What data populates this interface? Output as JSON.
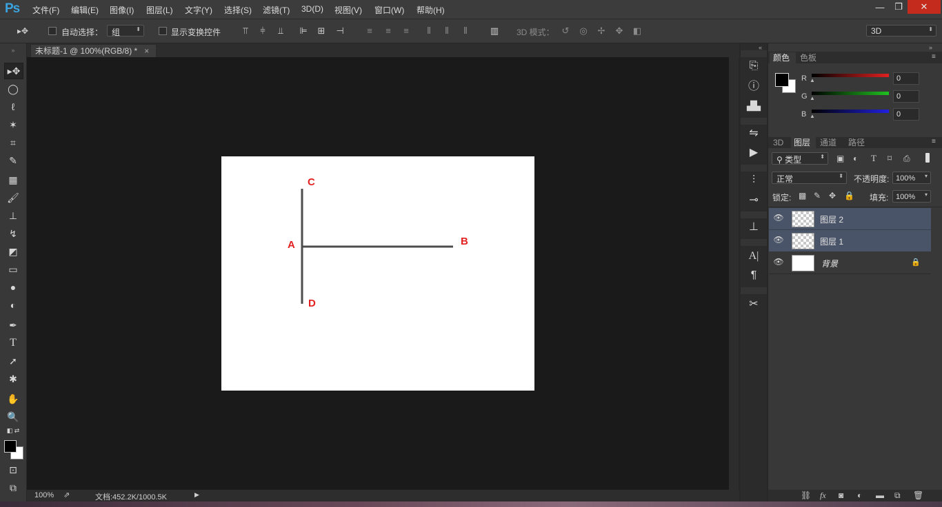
{
  "app": {
    "logo": "Ps"
  },
  "menu": [
    "文件(F)",
    "编辑(E)",
    "图像(I)",
    "图层(L)",
    "文字(Y)",
    "选择(S)",
    "滤镜(T)",
    "3D(D)",
    "视图(V)",
    "窗口(W)",
    "帮助(H)"
  ],
  "window_controls": {
    "minimize": "—",
    "restore": "❐",
    "close": "✕"
  },
  "options": {
    "auto_select_label": "自动选择：",
    "auto_select_value": "组",
    "show_transform_label": "显示变换控件",
    "mode3d_label": "3D 模式：",
    "workspace_value": "3D"
  },
  "document": {
    "tab_title": "未标题-1 @ 100%(RGB/8) *",
    "tab_close": "×",
    "zoom": "100%",
    "doc_info": "文档:452.2K/1000.5K"
  },
  "canvas": {
    "labels": {
      "a": "A",
      "b": "B",
      "c": "C",
      "d": "D"
    },
    "line_color": "#4d4d4d",
    "label_color": "#e32020"
  },
  "color_panel": {
    "tabs": [
      "颜色",
      "色板"
    ],
    "channels": [
      {
        "name": "R",
        "value": "0",
        "color": "#e02020"
      },
      {
        "name": "G",
        "value": "0",
        "color": "#20c020"
      },
      {
        "name": "B",
        "value": "0",
        "color": "#2020e0"
      }
    ]
  },
  "layers_panel": {
    "tabs": [
      "3D",
      "图层",
      "通道",
      "路径"
    ],
    "filter_kind": "类型",
    "blend_mode": "正常",
    "opacity_label": "不透明度:",
    "opacity_value": "100%",
    "lock_label": "锁定:",
    "fill_label": "填充:",
    "fill_value": "100%",
    "layers": [
      {
        "name": "图层 2",
        "selected": true
      },
      {
        "name": "图层 1",
        "selected": true
      },
      {
        "name": "背景",
        "selected": false,
        "locked": true
      }
    ]
  }
}
